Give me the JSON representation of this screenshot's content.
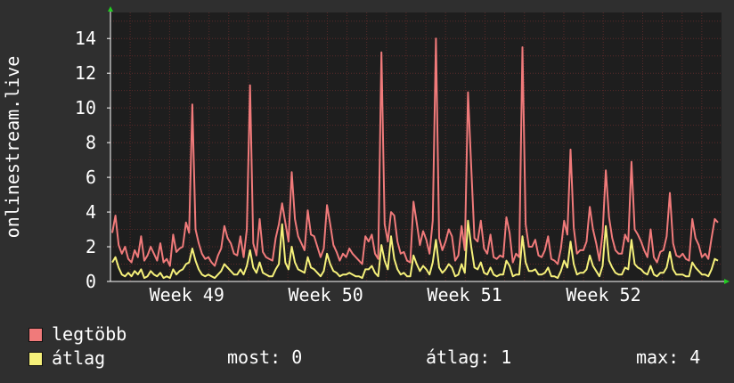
{
  "chart_data": {
    "type": "line",
    "ylabel": "onlinestream.live",
    "y_ticks": [
      "0",
      "2",
      "4",
      "6",
      "8",
      "10",
      "12",
      "14"
    ],
    "ylim": [
      0,
      15.5
    ],
    "x_ticks": [
      "Week 49",
      "Week 50",
      "Week 51",
      "Week 52"
    ],
    "grid": true,
    "legend_position": "bottom-left",
    "colors": {
      "background": "#2f2f2f",
      "plot_area": "#1e1e1e",
      "grid": "#5a2a2a",
      "axis": "#ffffff",
      "max_series": "#f07a7a",
      "avg_series": "#f5f07a"
    },
    "series": [
      {
        "name": "legtöbb",
        "color": "#f07a7a",
        "values": [
          2.8,
          3.8,
          2.1,
          1.6,
          2.0,
          1.3,
          1.1,
          1.8,
          1.4,
          2.6,
          1.2,
          1.5,
          2.0,
          1.6,
          1.2,
          2.2,
          1.1,
          1.3,
          0.9,
          2.7,
          1.7,
          1.9,
          2.0,
          3.4,
          2.8,
          10.2,
          3.0,
          2.2,
          1.6,
          1.3,
          1.4,
          1.1,
          0.9,
          1.5,
          1.9,
          3.2,
          2.5,
          2.2,
          1.6,
          1.5,
          2.6,
          1.4,
          3.0,
          11.3,
          2.2,
          1.5,
          3.6,
          1.7,
          1.4,
          1.3,
          1.2,
          2.5,
          3.3,
          4.5,
          3.4,
          2.3,
          6.3,
          3.6,
          2.6,
          2.2,
          1.8,
          4.1,
          2.7,
          2.6,
          2.0,
          1.4,
          1.9,
          4.4,
          3.3,
          2.1,
          1.7,
          1.2,
          1.6,
          1.4,
          1.9,
          1.6,
          1.4,
          1.2,
          1.0,
          2.6,
          2.3,
          2.7,
          1.6,
          1.3,
          13.2,
          3.3,
          2.3,
          4.0,
          3.8,
          2.3,
          1.6,
          1.7,
          1.2,
          1.1,
          4.6,
          3.4,
          2.1,
          2.9,
          2.4,
          1.6,
          3.5,
          14.0,
          2.5,
          1.8,
          2.3,
          3.0,
          2.6,
          1.2,
          1.5,
          3.2,
          1.8,
          10.9,
          6.6,
          2.5,
          2.3,
          3.5,
          1.9,
          1.6,
          2.7,
          1.4,
          1.3,
          1.5,
          1.4,
          3.7,
          2.8,
          1.1,
          1.6,
          1.4,
          13.5,
          3.3,
          2.0,
          2.0,
          2.4,
          1.5,
          1.4,
          1.8,
          2.6,
          1.3,
          1.2,
          1.0,
          1.9,
          3.5,
          2.7,
          7.6,
          3.1,
          1.6,
          1.8,
          1.8,
          2.3,
          4.3,
          3.0,
          2.2,
          1.2,
          2.8,
          6.4,
          3.7,
          2.5,
          1.8,
          1.6,
          1.6,
          2.7,
          2.3,
          6.9,
          3.0,
          2.7,
          2.3,
          1.8,
          1.4,
          3.0,
          1.4,
          1.1,
          1.7,
          1.8,
          2.6,
          5.1,
          2.2,
          1.5,
          1.4,
          1.6,
          1.3,
          1.2,
          3.6,
          2.5,
          2.1,
          1.4,
          1.6,
          1.3,
          2.5,
          3.6,
          3.4
        ]
      },
      {
        "name": "átlag",
        "color": "#f5f07a",
        "values": [
          1.1,
          1.4,
          0.8,
          0.4,
          0.3,
          0.5,
          0.3,
          0.6,
          0.4,
          0.7,
          0.2,
          0.3,
          0.6,
          0.4,
          0.3,
          0.5,
          0.2,
          0.3,
          0.2,
          0.7,
          0.4,
          0.6,
          0.7,
          1.0,
          1.1,
          1.9,
          1.2,
          0.7,
          0.4,
          0.3,
          0.4,
          0.3,
          0.2,
          0.4,
          0.6,
          1.0,
          0.8,
          0.6,
          0.4,
          0.4,
          0.7,
          0.4,
          0.9,
          1.8,
          0.8,
          0.5,
          1.1,
          0.5,
          0.4,
          0.3,
          0.3,
          0.7,
          1.0,
          3.3,
          1.1,
          0.7,
          2.0,
          1.1,
          0.7,
          0.6,
          0.5,
          1.4,
          0.8,
          0.7,
          0.5,
          0.3,
          0.6,
          1.6,
          1.0,
          0.6,
          0.5,
          0.3,
          0.4,
          0.4,
          0.5,
          0.4,
          0.3,
          0.3,
          0.2,
          0.7,
          0.7,
          0.9,
          0.5,
          0.3,
          2.1,
          1.2,
          0.7,
          2.6,
          1.3,
          0.7,
          0.4,
          0.5,
          0.3,
          0.3,
          1.5,
          1.0,
          0.6,
          0.9,
          0.7,
          0.4,
          1.1,
          2.4,
          0.8,
          0.5,
          0.7,
          1.0,
          0.8,
          0.3,
          0.4,
          1.0,
          0.5,
          3.5,
          2.0,
          0.8,
          0.7,
          1.1,
          0.5,
          0.4,
          0.8,
          0.4,
          0.3,
          0.4,
          0.4,
          1.2,
          0.9,
          0.3,
          0.4,
          0.4,
          2.6,
          1.1,
          0.6,
          0.6,
          0.7,
          0.4,
          0.4,
          0.5,
          0.8,
          0.3,
          0.3,
          0.2,
          0.6,
          1.2,
          0.8,
          2.3,
          1.0,
          0.4,
          0.5,
          0.5,
          0.7,
          1.5,
          0.9,
          0.6,
          0.3,
          0.9,
          3.2,
          1.2,
          0.8,
          0.5,
          0.4,
          0.4,
          0.8,
          0.7,
          2.4,
          1.0,
          0.8,
          0.7,
          0.5,
          0.4,
          0.9,
          0.4,
          0.3,
          0.5,
          0.5,
          0.8,
          1.7,
          0.7,
          0.4,
          0.4,
          0.4,
          0.3,
          0.3,
          1.1,
          0.8,
          0.6,
          0.4,
          0.4,
          0.3,
          0.7,
          1.3,
          1.2
        ]
      }
    ]
  },
  "legend": {
    "items": [
      {
        "label": "legtöbb",
        "color": "#f07a7a"
      },
      {
        "label": "átlag",
        "color": "#f5f07a"
      }
    ]
  },
  "stats": {
    "current": "most: 0",
    "average": "átlag: 1",
    "max": "max: 4"
  }
}
